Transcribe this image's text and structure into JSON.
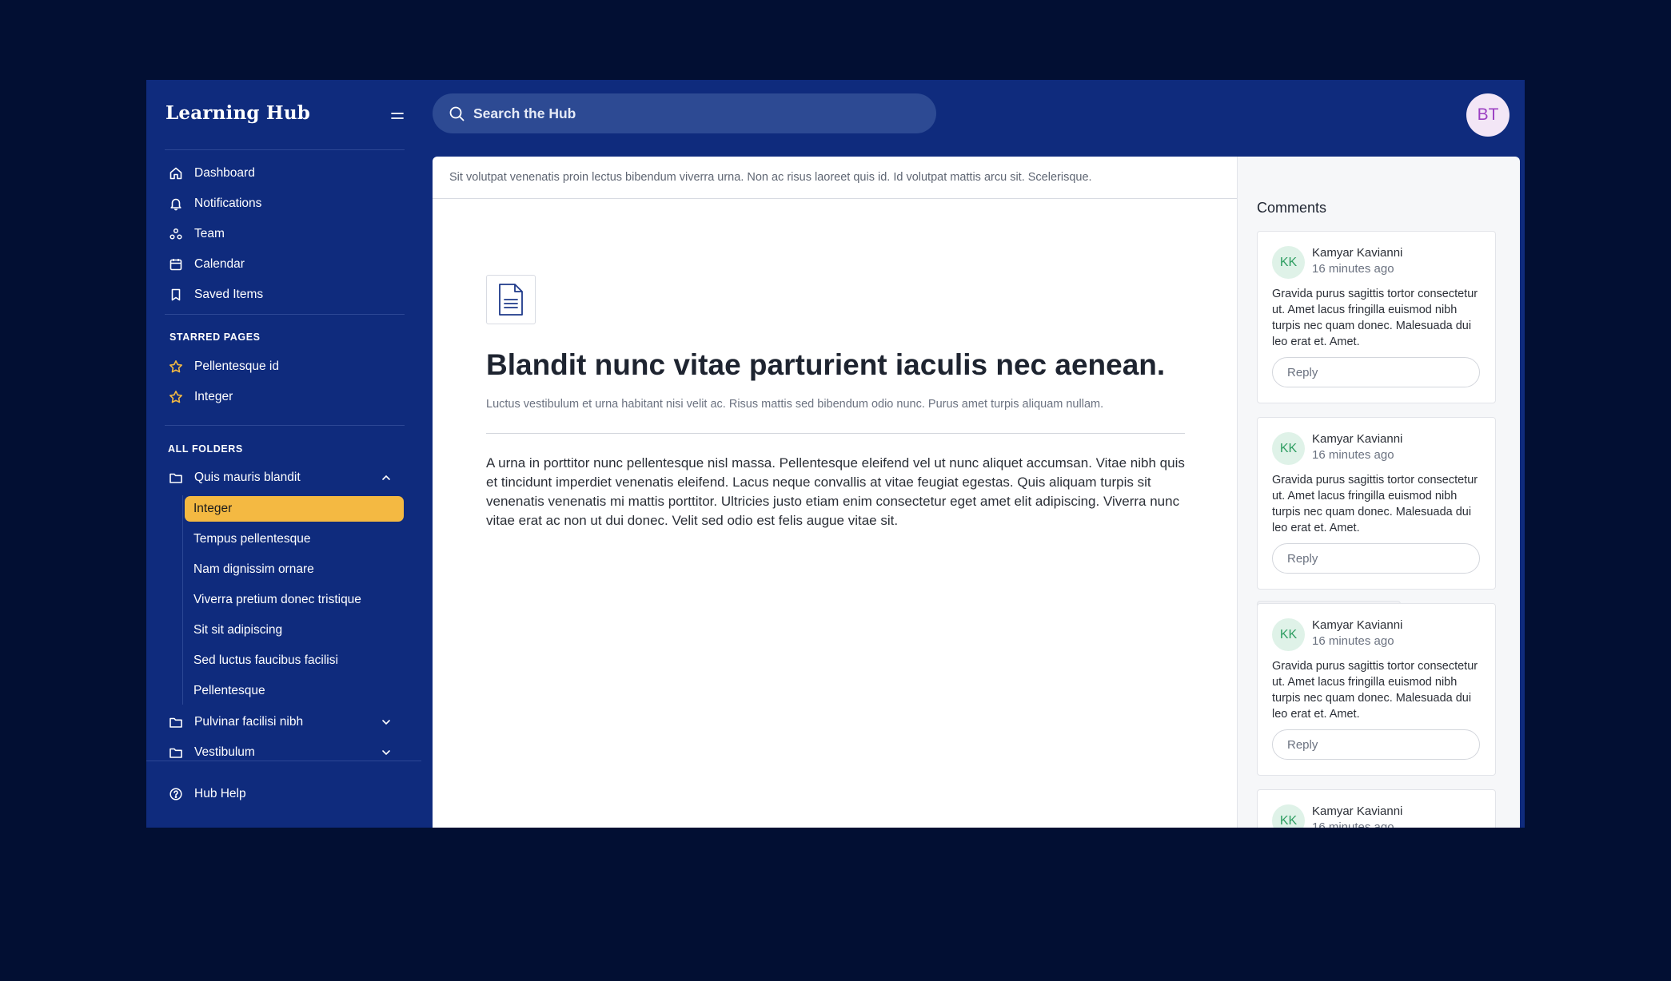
{
  "app": {
    "brand": "Learning Hub",
    "user_initials": "BT"
  },
  "search": {
    "placeholder": "Search the Hub"
  },
  "nav": [
    {
      "label": "Dashboard",
      "icon": "home-icon"
    },
    {
      "label": "Notifications",
      "icon": "bell-icon"
    },
    {
      "label": "Team",
      "icon": "team-icon"
    },
    {
      "label": "Calendar",
      "icon": "calendar-icon"
    },
    {
      "label": "Saved Items",
      "icon": "bookmark-icon"
    }
  ],
  "starred": {
    "title": "STARRED PAGES",
    "items": [
      {
        "label": "Pellentesque id"
      },
      {
        "label": "Integer"
      }
    ]
  },
  "folders": {
    "title": "ALL FOLDERS",
    "items": [
      {
        "label": "Quis mauris blandit",
        "expanded": true
      },
      {
        "label": "Pulvinar facilisi nibh",
        "expanded": false
      },
      {
        "label": "Vestibulum",
        "expanded": false
      }
    ],
    "children": [
      {
        "label": "Integer",
        "active": true
      },
      {
        "label": "Tempus pellentesque"
      },
      {
        "label": "Nam dignissim ornare"
      },
      {
        "label": "Viverra pretium donec tristique"
      },
      {
        "label": "Sit sit adipiscing"
      },
      {
        "label": "Sed luctus faucibus facilisi"
      },
      {
        "label": "Pellentesque"
      }
    ]
  },
  "help": {
    "label": "Hub Help"
  },
  "document": {
    "banner": "Sit volutpat venenatis proin lectus bibendum viverra urna. Non ac risus laoreet quis id. Id volutpat mattis arcu sit. Scelerisque.",
    "title": "Blandit nunc vitae parturient iaculis nec aenean.",
    "subtitle": "Luctus vestibulum et urna habitant nisi velit ac. Risus mattis sed bibendum odio nunc. Purus amet turpis aliquam nullam.",
    "body": "A urna in porttitor nunc pellentesque nisl massa. Pellentesque eleifend vel ut nunc aliquet accumsan. Vitae nibh quis et tincidunt imperdiet venenatis eleifend. Lacus neque convallis at vitae feugiat egestas. Quis aliquam turpis sit venenatis venenatis mi mattis porttitor. Ultricies justo etiam enim consectetur eget amet elit adipiscing. Viverra nunc vitae erat ac non ut dui donec. Velit sed odio est felis augue vitae sit."
  },
  "comments": {
    "title": "Comments",
    "reply_placeholder": "Reply",
    "items": [
      {
        "initials": "KK",
        "author": "Kamyar Kavianni",
        "time": "16 minutes ago",
        "text": "Gravida purus sagittis tortor consectetur ut. Amet lacus fringilla euismod nibh turpis nec quam donec. Malesuada dui leo erat et. Amet."
      },
      {
        "initials": "KK",
        "author": "Kamyar Kavianni",
        "time": "16 minutes ago",
        "text": "Gravida purus sagittis tortor consectetur ut. Amet lacus fringilla euismod nibh turpis nec quam donec. Malesuada dui leo erat et. Amet."
      },
      {
        "initials": "KK",
        "author": "Kamyar Kavianni",
        "time": "16 minutes ago",
        "text": "Gravida purus sagittis tortor consectetur ut. Amet lacus fringilla euismod nibh turpis nec quam donec. Malesuada dui leo erat et. Amet."
      },
      {
        "initials": "KK",
        "author": "Kamyar Kavianni",
        "time": "16 minutes ago",
        "text": ""
      }
    ]
  },
  "colors": {
    "background": "#020f33",
    "sidebar": "#0f2b7d",
    "accent": "#f4b942",
    "avatar_text": "#9b3fc2",
    "comment_avatar": "#2f9e62"
  }
}
